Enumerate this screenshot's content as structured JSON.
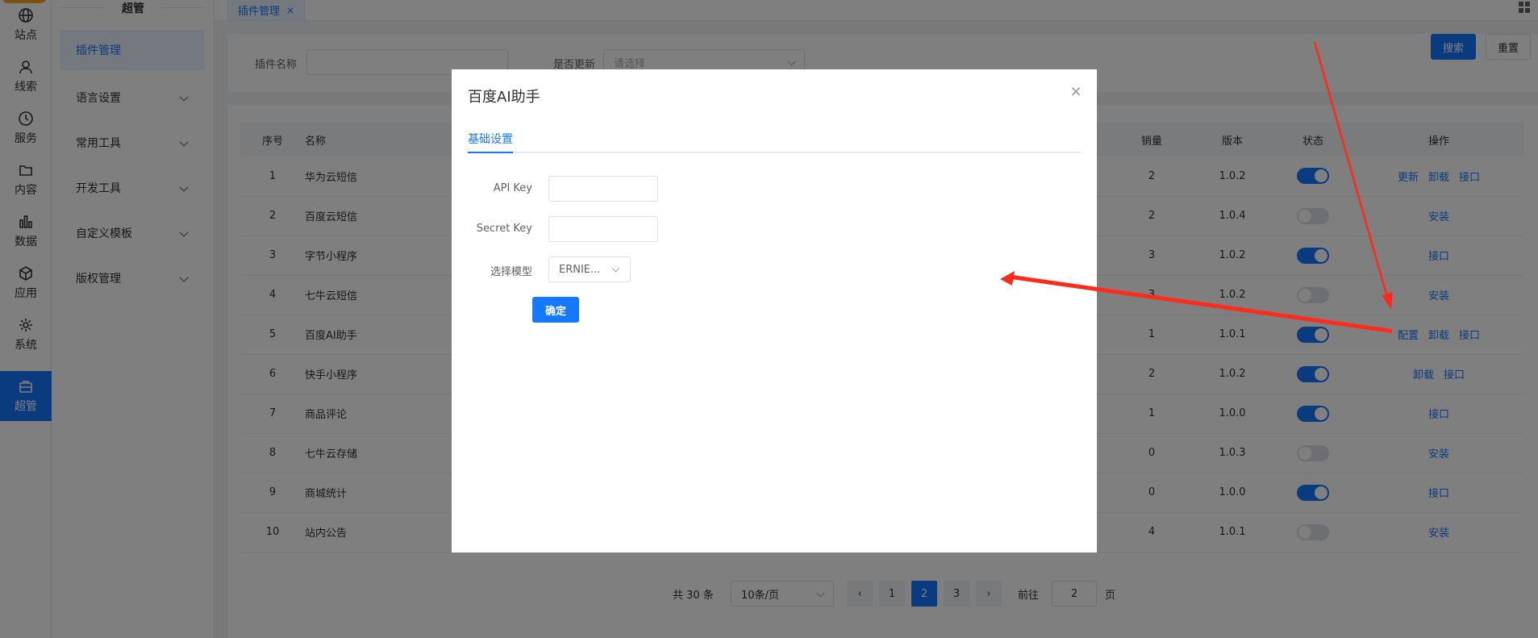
{
  "rail": [
    {
      "label": "站点",
      "icon": "globe-icon"
    },
    {
      "label": "线索",
      "icon": "user-icon"
    },
    {
      "label": "服务",
      "icon": "clock-icon"
    },
    {
      "label": "内容",
      "icon": "folder-icon"
    },
    {
      "label": "数据",
      "icon": "bar-chart-icon"
    },
    {
      "label": "应用",
      "icon": "box-icon"
    },
    {
      "label": "系统",
      "icon": "gear-icon"
    },
    {
      "label": "超管",
      "icon": "briefcase-icon"
    }
  ],
  "menu": {
    "title": "超管",
    "items": [
      {
        "label": "插件管理"
      },
      {
        "label": "语言设置"
      },
      {
        "label": "常用工具"
      },
      {
        "label": "开发工具"
      },
      {
        "label": "自定义模板"
      },
      {
        "label": "版权管理"
      }
    ]
  },
  "tabs": {
    "active": "插件管理",
    "close": "×"
  },
  "filter": {
    "name_label": "插件名称",
    "update_label": "是否更新",
    "update_placeholder": "请选择",
    "search": "搜索",
    "reset": "重置"
  },
  "table": {
    "headers": [
      "序号",
      "名称",
      "销量",
      "版本",
      "状态",
      "操作"
    ],
    "rows": [
      {
        "no": "1",
        "name": "华为云短信",
        "sales": "2",
        "version": "1.0.2",
        "on": true,
        "actions": [
          "更新",
          "卸载",
          "接口"
        ]
      },
      {
        "no": "2",
        "name": "百度云短信",
        "sales": "2",
        "version": "1.0.4",
        "on": false,
        "actions": [
          "安装"
        ]
      },
      {
        "no": "3",
        "name": "字节小程序",
        "sales": "3",
        "version": "1.0.2",
        "on": true,
        "actions": [
          "接口"
        ]
      },
      {
        "no": "4",
        "name": "七牛云短信",
        "sales": "3",
        "version": "1.0.2",
        "on": false,
        "actions": [
          "安装"
        ]
      },
      {
        "no": "5",
        "name": "百度AI助手",
        "sales": "1",
        "version": "1.0.1",
        "on": true,
        "actions": [
          "配置",
          "卸载",
          "接口"
        ]
      },
      {
        "no": "6",
        "name": "快手小程序",
        "sales": "2",
        "version": "1.0.2",
        "on": true,
        "actions": [
          "卸载",
          "接口"
        ]
      },
      {
        "no": "7",
        "name": "商品评论",
        "sales": "1",
        "version": "1.0.0",
        "on": true,
        "actions": [
          "接口"
        ]
      },
      {
        "no": "8",
        "name": "七牛云存储",
        "sales": "0",
        "version": "1.0.3",
        "on": false,
        "actions": [
          "安装"
        ]
      },
      {
        "no": "9",
        "name": "商城统计",
        "sales": "0",
        "version": "1.0.0",
        "on": true,
        "actions": [
          "接口"
        ]
      },
      {
        "no": "10",
        "name": "站内公告",
        "sales": "4",
        "version": "1.0.1",
        "on": false,
        "actions": [
          "安装"
        ]
      }
    ]
  },
  "pager": {
    "total": "共 30 条",
    "size": "10条/页",
    "pages": [
      "1",
      "2",
      "3"
    ],
    "current": "2",
    "goto_label": "前往",
    "goto_value": "2",
    "page_unit": "页"
  },
  "dialog": {
    "title": "百度AI助手",
    "close": "×",
    "tab": "基础设置",
    "api_key_label": "API Key",
    "secret_key_label": "Secret Key",
    "model_label": "选择模型",
    "model_value": "ERNIE...",
    "confirm": "确定"
  },
  "colors": {
    "primary": "#1677ff",
    "annotation": "#ff2a1a"
  }
}
